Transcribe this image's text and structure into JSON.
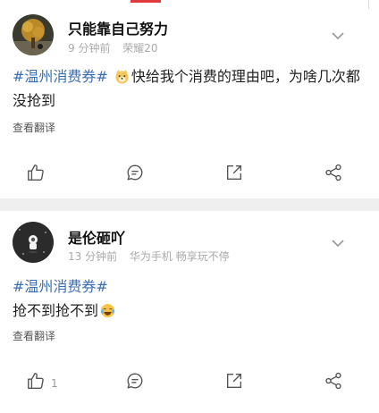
{
  "posts": [
    {
      "username": "只能靠自己努力",
      "time": "9 分钟前",
      "device": "荣耀20",
      "hashtag": "#温州消费券#",
      "text": "快给我个消费的理由吧，为啥几次都没抢到",
      "translate_label": "查看翻译",
      "emoji": "doge-emoji",
      "like_count": ""
    },
    {
      "username": "是伦砸吖",
      "time": "13 分钟前",
      "device": "华为手机 畅享玩不停",
      "hashtag": "#温州消费券#",
      "text": "抢不到抢不到",
      "translate_label": "查看翻译",
      "emoji": "laughing-crying-emoji",
      "like_count": "1"
    }
  ],
  "colors": {
    "accent": "#e0393e",
    "hashtag": "#3b6fb3",
    "meta": "#aaaaaa",
    "icon": "#555555"
  },
  "icons": [
    "thumbs-up-icon",
    "comment-icon",
    "share-icon",
    "more-share-icon",
    "chevron-down-icon"
  ]
}
